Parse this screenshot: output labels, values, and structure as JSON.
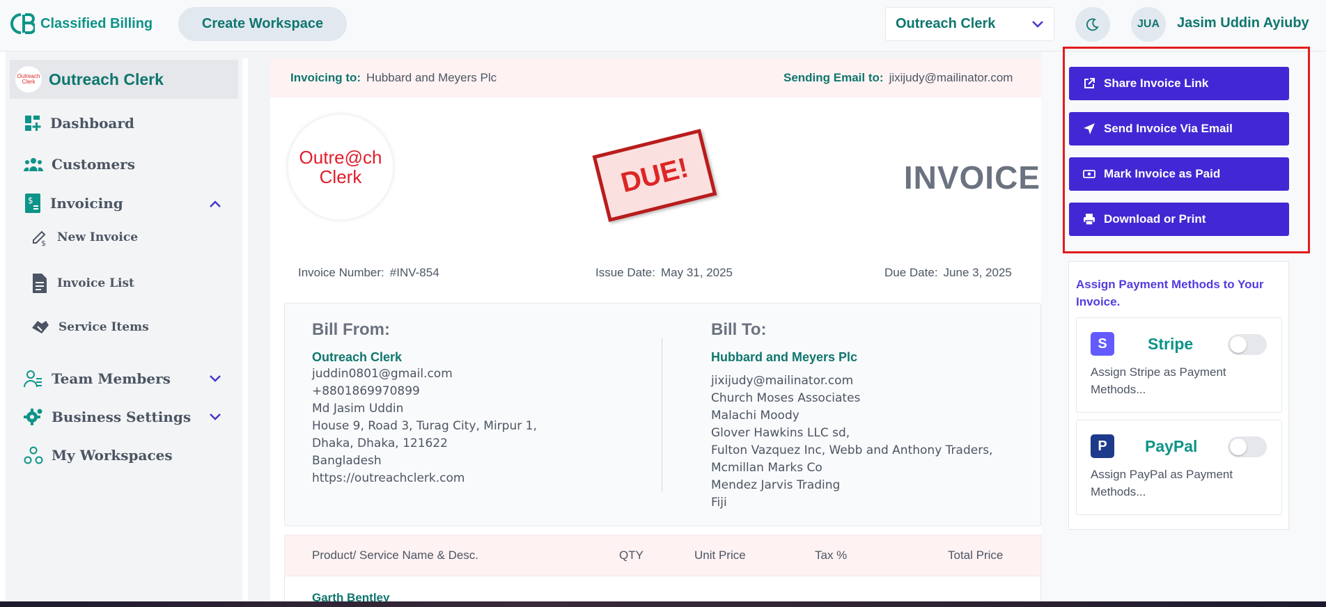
{
  "header": {
    "brand": "Classified Billing",
    "create_workspace": "Create Workspace",
    "workspace_select": "Outreach Clerk",
    "avatar_initials": "JUA",
    "user_name": "Jasim Uddin Ayiuby"
  },
  "sidebar": {
    "org_name": "Outreach Clerk",
    "org_logo_text_1": "Outreach",
    "org_logo_text_2": "Clerk",
    "items": [
      {
        "label": "Dashboard",
        "icon": "dashboard-icon"
      },
      {
        "label": "Customers",
        "icon": "customers-icon"
      },
      {
        "label": "Invoicing",
        "icon": "invoice-icon",
        "expanded": true
      },
      {
        "label": "New Invoice",
        "icon": "new-invoice-icon"
      },
      {
        "label": "Invoice List",
        "icon": "invoice-list-icon"
      },
      {
        "label": "Service Items",
        "icon": "service-items-icon"
      },
      {
        "label": "Team Members",
        "icon": "team-icon"
      },
      {
        "label": "Business Settings",
        "icon": "settings-icon"
      },
      {
        "label": "My Workspaces",
        "icon": "workspaces-icon"
      }
    ]
  },
  "invoice": {
    "invoicing_to_label": "Invoicing to:",
    "invoicing_to_value": "Hubbard and Meyers Plc",
    "sending_email_label": "Sending Email to:",
    "sending_email_value": "jixijudy@mailinator.com",
    "logo_line_1": "Outre@ch",
    "logo_line_2": "Clerk",
    "stamp": "DUE!",
    "title": "INVOICE",
    "number_label": "Invoice Number:",
    "number_value": "#INV-854",
    "issue_label": "Issue Date:",
    "issue_value": "May 31, 2025",
    "due_label": "Due Date:",
    "due_value": "June 3, 2025",
    "bill_from": {
      "heading": "Bill From:",
      "name": "Outreach Clerk",
      "lines": [
        "juddin0801@gmail.com",
        "+8801869970899",
        "Md Jasim Uddin",
        "House 9, Road 3, Turag City, Mirpur 1,",
        "Dhaka, Dhaka, 121622",
        "Bangladesh",
        "https://outreachclerk.com"
      ]
    },
    "bill_to": {
      "heading": "Bill To:",
      "name": "Hubbard and Meyers Plc",
      "lines": [
        "jixijudy@mailinator.com",
        "Church Moses Associates",
        "Malachi Moody",
        "Glover Hawkins LLC sd,",
        "Fulton Vazquez Inc, Webb and Anthony Traders,",
        "Mcmillan Marks Co",
        "Mendez Jarvis Trading",
        "Fiji"
      ]
    },
    "table": {
      "headers": [
        "Product/ Service Name & Desc.",
        "QTY",
        "Unit Price",
        "Tax %",
        "Total Price"
      ],
      "rows": [
        {
          "name": "Garth Bentley"
        }
      ]
    }
  },
  "actions": {
    "share": "Share Invoice Link",
    "email": "Send Invoice Via Email",
    "paid": "Mark Invoice as Paid",
    "print": "Download or Print"
  },
  "payments": {
    "title": "Assign Payment Methods to Your Invoice.",
    "methods": [
      {
        "name": "Stripe",
        "icon_letter": "S",
        "desc": "Assign Stripe as Payment Methods...",
        "enabled": false,
        "color": "#635bff"
      },
      {
        "name": "PayPal",
        "icon_letter": "P",
        "desc": "Assign PayPal as Payment Methods...",
        "enabled": false,
        "color": "#1e3a8a"
      }
    ]
  },
  "colors": {
    "accent_teal": "#0f766e",
    "action_purple": "#4228d4",
    "highlight_red": "#e31b1b",
    "stamp_red": "#b91c1c"
  }
}
